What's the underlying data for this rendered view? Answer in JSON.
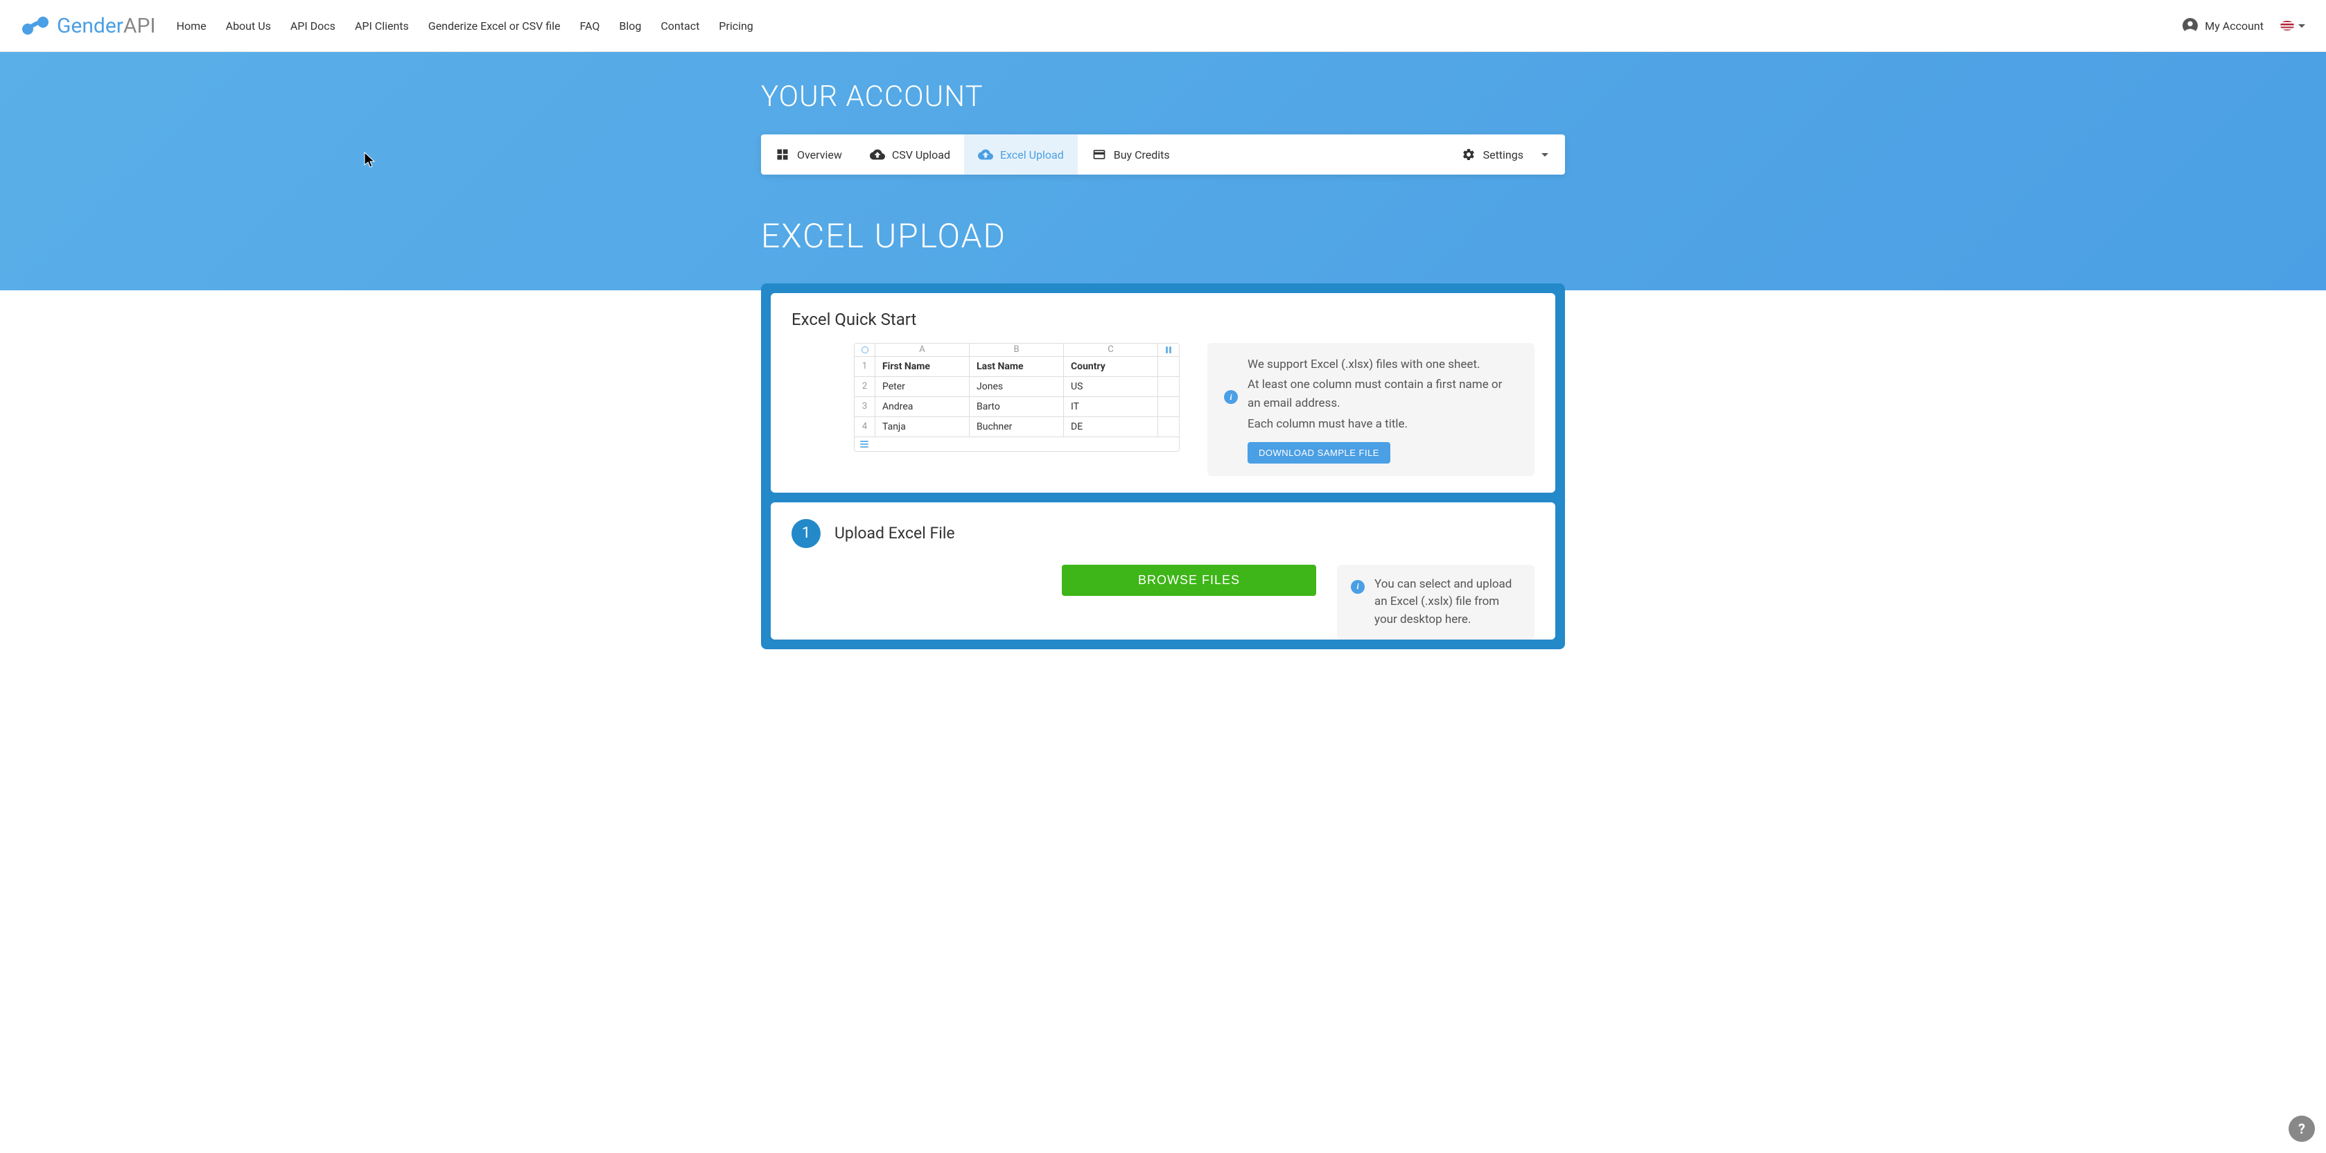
{
  "brand": {
    "name_part1": "Gender",
    "name_part2": "API"
  },
  "nav": {
    "home": "Home",
    "about": "About Us",
    "api_docs": "API Docs",
    "api_clients": "API Clients",
    "genderize": "Genderize Excel or CSV file",
    "faq": "FAQ",
    "blog": "Blog",
    "contact": "Contact",
    "pricing": "Pricing"
  },
  "header_right": {
    "my_account": "My Account"
  },
  "page": {
    "title": "YOUR ACCOUNT",
    "section_title": "EXCEL UPLOAD"
  },
  "tabs": {
    "overview": "Overview",
    "csv_upload": "CSV Upload",
    "excel_upload": "Excel Upload",
    "buy_credits": "Buy Credits",
    "settings": "Settings"
  },
  "quick_start": {
    "title": "Excel Quick Start",
    "info_line1": "We support Excel (.xlsx) files with one sheet.",
    "info_line2": "At least one column must contain a first name or an email address.",
    "info_line3": "Each column must have a title.",
    "download_btn": "DOWNLOAD SAMPLE FILE",
    "cols": {
      "a": "A",
      "b": "B",
      "c": "C"
    },
    "rows": [
      {
        "n": "1",
        "c1": "First Name",
        "c2": "Last Name",
        "c3": "Country"
      },
      {
        "n": "2",
        "c1": "Peter",
        "c2": "Jones",
        "c3": "US"
      },
      {
        "n": "3",
        "c1": "Andrea",
        "c2": "Barto",
        "c3": "IT"
      },
      {
        "n": "4",
        "c1": "Tanja",
        "c2": "Buchner",
        "c3": "DE"
      }
    ]
  },
  "step1": {
    "num": "1",
    "title": "Upload Excel File",
    "browse_btn": "BROWSE FILES",
    "info": "You can select and upload an Excel (.xslx) file from your desktop here."
  },
  "help": "?"
}
